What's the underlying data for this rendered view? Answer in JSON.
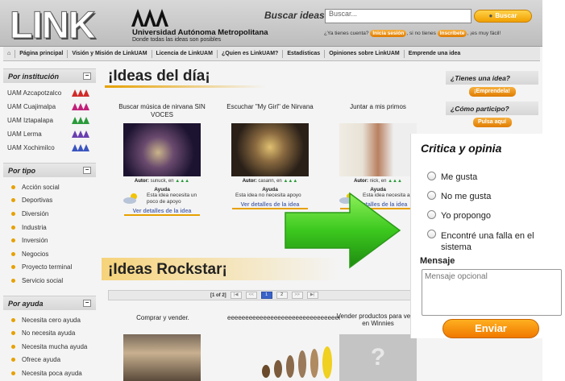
{
  "header": {
    "logo": "LINK",
    "university_name": "Universidad Autónoma Metropolitana",
    "university_tagline": "Donde todas las ideas son posibles",
    "search_label": "Buscar ideas",
    "search_placeholder": "Buscar...",
    "search_button": "Buscar",
    "account_q1": "¿Ya tienes cuenta?",
    "login": "Inicia sesión",
    "account_q2": ", si no tienes",
    "signup": "Inscríbete",
    "account_end": ", ¡es muy fácil!"
  },
  "nav": {
    "home_icon": "home-icon",
    "items": [
      "Página principal",
      "Visión y Misión de LinkUAM",
      "Licencia de LinkUAM",
      "¿Quien es LinkUAM?",
      "Estadísticas",
      "Opiniones sobre LinkUAM",
      "Emprende una idea"
    ]
  },
  "sidebar": {
    "institution_title": "Por institución",
    "institutions": [
      "UAM Azcapotzalco",
      "UAM Cuajimalpa",
      "UAM Iztapalapa",
      "UAM Lerma",
      "UAM Xochimilco"
    ],
    "type_title": "Por tipo",
    "types": [
      "Acción social",
      "Deportivas",
      "Diversión",
      "Industria",
      "Inversión",
      "Negocios",
      "Proyecto terminal",
      "Servicio social"
    ],
    "help_title": "Por ayuda",
    "helps": [
      "Necesita cero ayuda",
      "No necesita ayuda",
      "Necesita mucha ayuda",
      "Ofrece ayuda",
      "Necesita poca ayuda"
    ]
  },
  "ideas_del_dia": {
    "title": "¡Ideas del día¡",
    "items": [
      {
        "title": "Buscar música de nirvana SIN VOCES",
        "author_label": "Autor:",
        "author": "sunuck",
        "en": ", en",
        "help_label": "Ayuda",
        "help_text": "Esta idea necesita un poco de apoyo",
        "details": "Ver detalles de la idea"
      },
      {
        "title": "Escuchar \"My Girl\" de Nirvana",
        "author_label": "Autor:",
        "author": "casann",
        "en": ", en",
        "help_label": "Ayuda",
        "help_text": "Esta idea no necesita apoyo",
        "details": "Ver detalles de la idea"
      },
      {
        "title": "Juntar a mis primos",
        "author_label": "Autor:",
        "author": "nick",
        "en": ", en",
        "help_label": "Ayuda",
        "help_text": "Esta idea necesita apoyo",
        "details": "Ver detalles de la idea"
      }
    ]
  },
  "rockstar": {
    "title": "¡Ideas Rockstar¡",
    "pager_label": "[1 of 2]",
    "pages": [
      "1",
      "2"
    ],
    "items": [
      {
        "title": "Comprar y vender."
      },
      {
        "title": "eeeeeeeeeeeeeeeeeeeeeeeeeeeeeeeeeeeeeeeeeeeeeeeeee"
      },
      {
        "title": "Vender productos para venta en Winnies"
      }
    ]
  },
  "right_sidebar": {
    "q1": "¿Tienes una idea?",
    "b1": "¡Emprendela!",
    "q2": "¿Cómo participo?",
    "b2": "Pulsa aquí"
  },
  "feedback": {
    "title": "Critica y opinia",
    "options": [
      "Me gusta",
      "No me gusta",
      "Yo propongo",
      "Encontré una falla en el sistema"
    ],
    "message_label": "Mensaje",
    "message_placeholder": "Mensaje opcional",
    "send": "Enviar"
  },
  "colors": {
    "accent": "#e6a100",
    "button": "#f08c00",
    "link": "#5a6fb0",
    "arrow": "#3cc81e"
  }
}
